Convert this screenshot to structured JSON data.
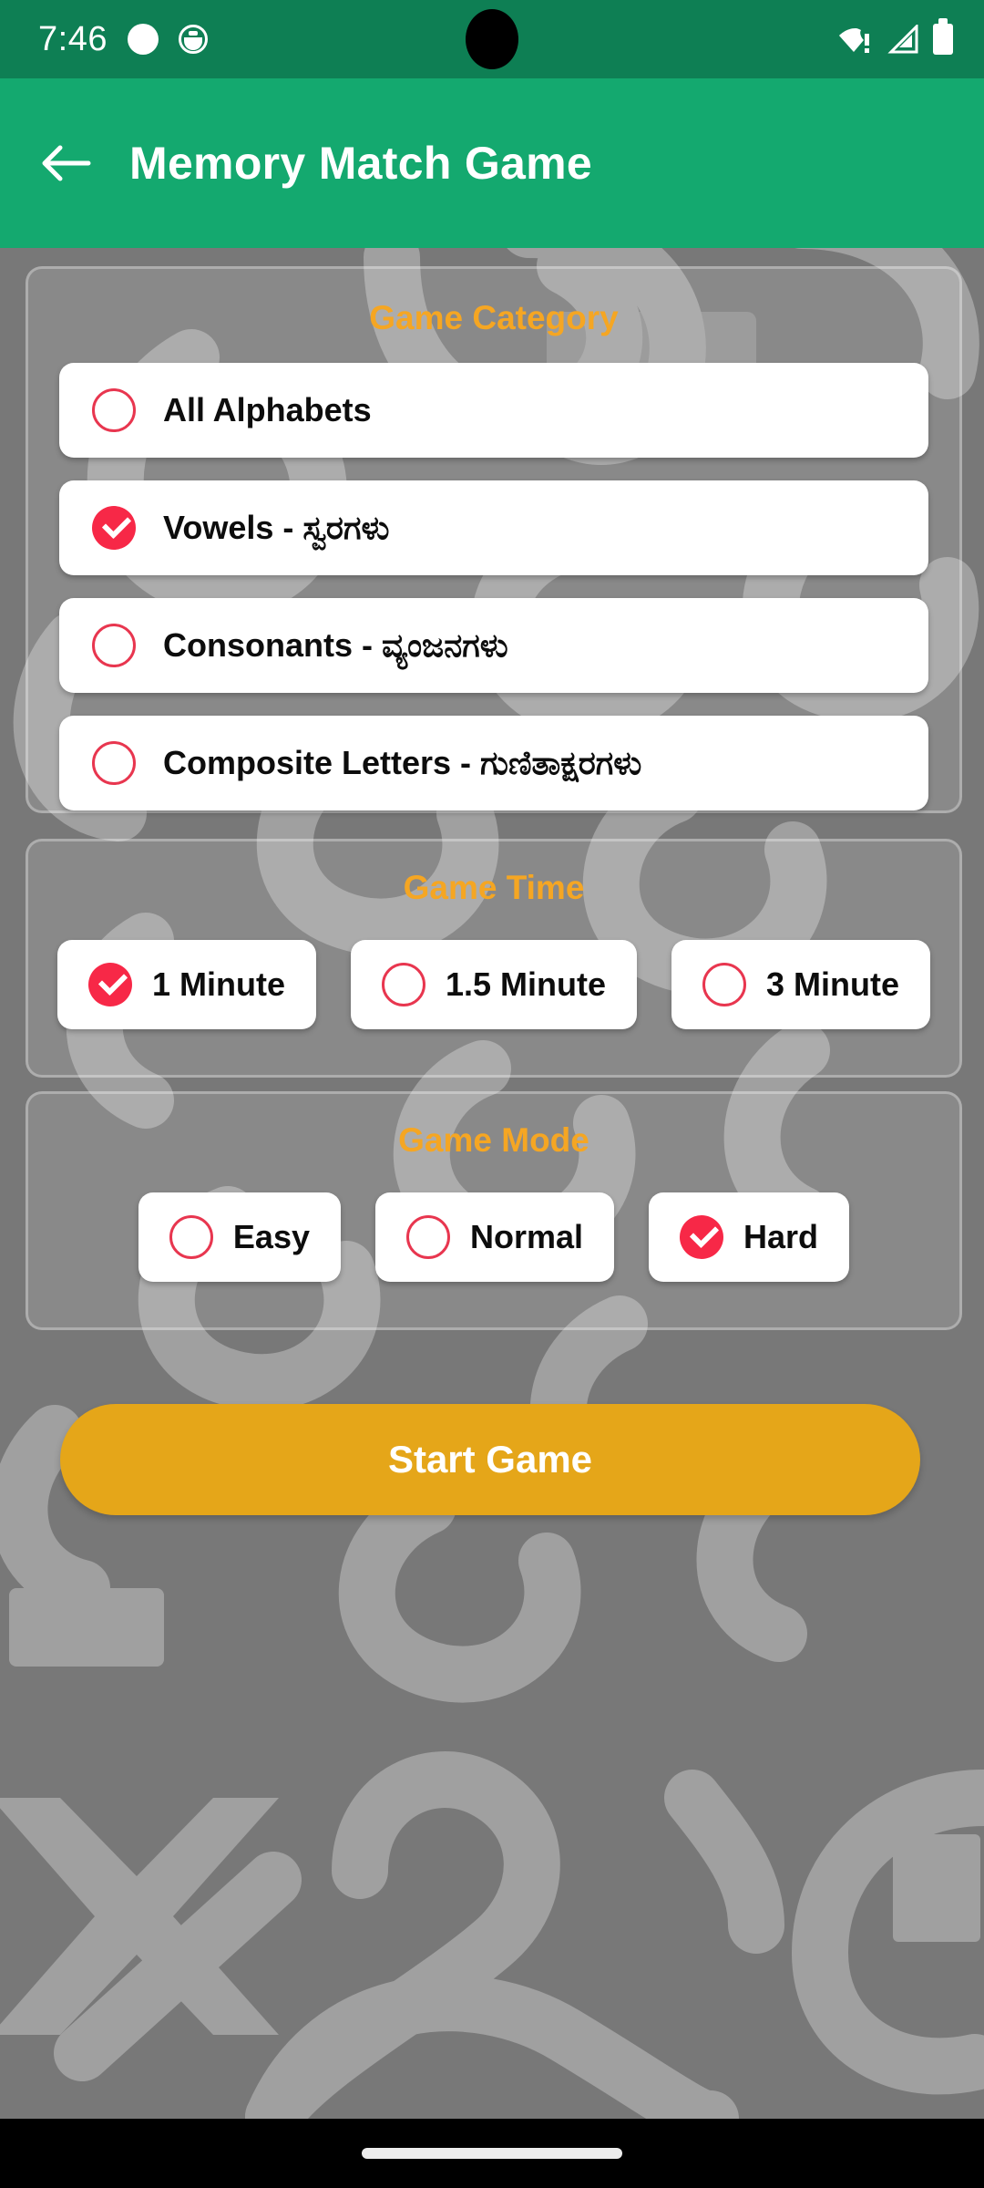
{
  "status_bar": {
    "time": "7:46",
    "icons": [
      "notification-dot-icon",
      "notification-face-icon",
      "wifi-warning-icon",
      "cellular-signal-icon",
      "battery-icon"
    ],
    "bg_color": "#0E7F54"
  },
  "app_bar": {
    "back_icon": "arrow-left-icon",
    "title": "Memory Match Game",
    "bg_color": "#14A96F",
    "title_color": "#FFFFFF"
  },
  "theme": {
    "accent_orange": "#F5A623",
    "radio_red": "#F72847",
    "radio_outline_red": "#E8364F",
    "button_amber": "#E5A619",
    "background_gray": "#787878",
    "pattern_gray": "#A0A0A0",
    "card_white": "#FFFFFF"
  },
  "sections": {
    "category": {
      "title": "Game Category",
      "options": [
        {
          "label": "All Alphabets",
          "selected": false
        },
        {
          "label": "Vowels - ಸ್ವರಗಳು",
          "selected": true
        },
        {
          "label": "Consonants - ವ್ಯಂಜನಗಳು",
          "selected": false
        },
        {
          "label": "Composite Letters - ಗುಣಿತಾಕ್ಷರಗಳು",
          "selected": false
        }
      ]
    },
    "time": {
      "title": "Game Time",
      "options": [
        {
          "label": "1 Minute",
          "selected": true
        },
        {
          "label": "1.5 Minute",
          "selected": false
        },
        {
          "label": "3 Minute",
          "selected": false
        }
      ]
    },
    "mode": {
      "title": "Game Mode",
      "options": [
        {
          "label": "Easy",
          "selected": false
        },
        {
          "label": "Normal",
          "selected": false
        },
        {
          "label": "Hard",
          "selected": true
        }
      ]
    }
  },
  "start_button": {
    "label": "Start Game"
  },
  "nav_bar": {
    "gesture_pill": "home-gesture-pill"
  }
}
